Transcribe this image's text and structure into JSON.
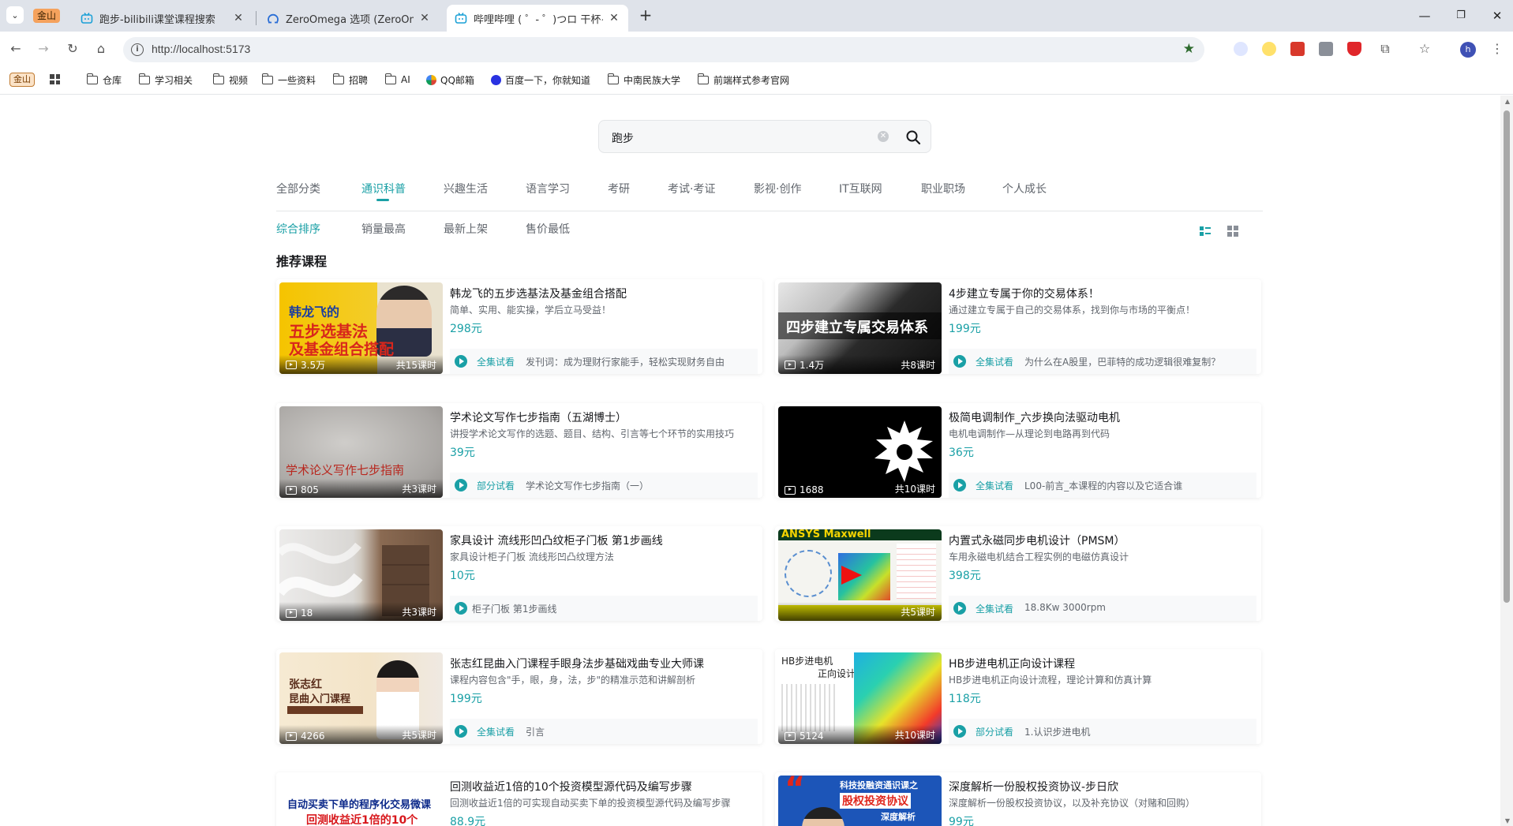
{
  "browser": {
    "tab_badge": "金山",
    "tabs": [
      {
        "title": "跑步-bilibili课堂课程搜索",
        "active": false
      },
      {
        "title": "ZeroOmega 选项 (ZeroOmeg",
        "active": false
      },
      {
        "title": "哔哩哔哩 ( ゜- ゜)つロ 干杯~-bi",
        "active": true
      }
    ],
    "url": "http://localhost:5173",
    "profile_initial": "h",
    "bookmark_badge": "金山",
    "bookmarks": [
      "仓库",
      "学习相关",
      "视频",
      "一些资料",
      "招聘",
      "AI",
      "QQ邮箱",
      "百度一下，你就知道",
      "中南民族大学",
      "前端样式参考官网"
    ]
  },
  "search": {
    "value": "跑步"
  },
  "categories": [
    "全部分类",
    "通识科普",
    "兴趣生活",
    "语言学习",
    "考研",
    "考试·考证",
    "影视·创作",
    "IT互联网",
    "职业职场",
    "个人成长"
  ],
  "active_category": "通识科普",
  "sorts": [
    "综合排序",
    "销量最高",
    "最新上架",
    "售价最低"
  ],
  "active_sort": "综合排序",
  "section_title": "推荐课程",
  "courses": [
    {
      "title": "韩龙飞的五步选基法及基金组合搭配",
      "desc": "简单、实用、能实操，学后立马受益！",
      "price": "298元",
      "views": "3.5万",
      "lessons": "共15课时",
      "trial": "全集试看",
      "episode": "发刊词：成为理财行家能手，轻松实现财务自由",
      "art": "韩龙飞的 五步选基法 及基金组合搭配"
    },
    {
      "title": "4步建立专属于你的交易体系！",
      "desc": "通过建立专属于自己的交易体系，找到你与市场的平衡点！",
      "price": "199元",
      "views": "1.4万",
      "lessons": "共8课时",
      "trial": "全集试看",
      "episode": "为什么在A股里，巴菲特的成功逻辑很难复制？",
      "art": "四步建立专属交易体系"
    },
    {
      "title": "学术论文写作七步指南（五湖博士）",
      "desc": "讲授学术论文写作的选题、题目、结构、引言等七个环节的实用技巧",
      "price": "39元",
      "views": "805",
      "lessons": "共3课时",
      "trial": "部分试看",
      "episode": "学术论文写作七步指南（一）",
      "art": "学术论义写作七步指南"
    },
    {
      "title": "极简电调制作_六步换向法驱动电机",
      "desc": "电机电调制作—从理论到电路再到代码",
      "price": "36元",
      "views": "1688",
      "lessons": "共10课时",
      "trial": "全集试看",
      "episode": "L00-前言_本课程的内容以及它适合谁",
      "art": ""
    },
    {
      "title": "家具设计 流线形凹凸纹柜子门板 第1步画线",
      "desc": "家具设计柜子门板 流线形凹凸纹理方法",
      "price": "10元",
      "views": "18",
      "lessons": "共3课时",
      "trial": "",
      "episode": "柜子门板 第1步画线",
      "art": ""
    },
    {
      "title": "内置式永磁同步电机设计（PMSM）",
      "desc": "车用永磁电机结合工程实例的电磁仿真设计",
      "price": "398元",
      "views": "",
      "lessons": "共5课时",
      "trial": "全集试看",
      "episode": "18.8Kw 3000rpm",
      "art": "ANSYS Maxwell"
    },
    {
      "title": "张志红昆曲入门课程手眼身法步基础戏曲专业大师课",
      "desc": "课程内容包含\"手，眼，身，法，步\"的精准示范和讲解剖析",
      "price": "199元",
      "views": "4266",
      "lessons": "共5课时",
      "trial": "全集试看",
      "episode": "引言",
      "art": "张志红 昆曲入门课程"
    },
    {
      "title": "HB步进电机正向设计课程",
      "desc": "HB步进电机正向设计流程，理论计算和仿真计算",
      "price": "118元",
      "views": "5124",
      "lessons": "共10课时",
      "trial": "部分试看",
      "episode": "1.认识步进电机",
      "art": "HB步进电机 正向设计"
    },
    {
      "title": "回测收益近1倍的10个投资模型源代码及编写步骤",
      "desc": "回测收益近1倍的可实现自动买卖下单的投资模型源代码及编写步骤",
      "price": "88.9元",
      "views": "",
      "lessons": "",
      "trial": "",
      "episode": "",
      "art": "自动买卖下单的程序化交易微课 回测收益近1倍的10个"
    },
    {
      "title": "深度解析一份股权投资协议-步日欣",
      "desc": "深度解析一份股权投资协议，以及补充协议（对赌和回购）",
      "price": "99元",
      "views": "",
      "lessons": "",
      "trial": "",
      "episode": "",
      "art": "科技投融资通识课之 股权投资协议 深度解析"
    }
  ],
  "colors": {
    "accent": "#1aa0a6",
    "text_primary": "#18191c",
    "text_secondary": "#61666d"
  }
}
